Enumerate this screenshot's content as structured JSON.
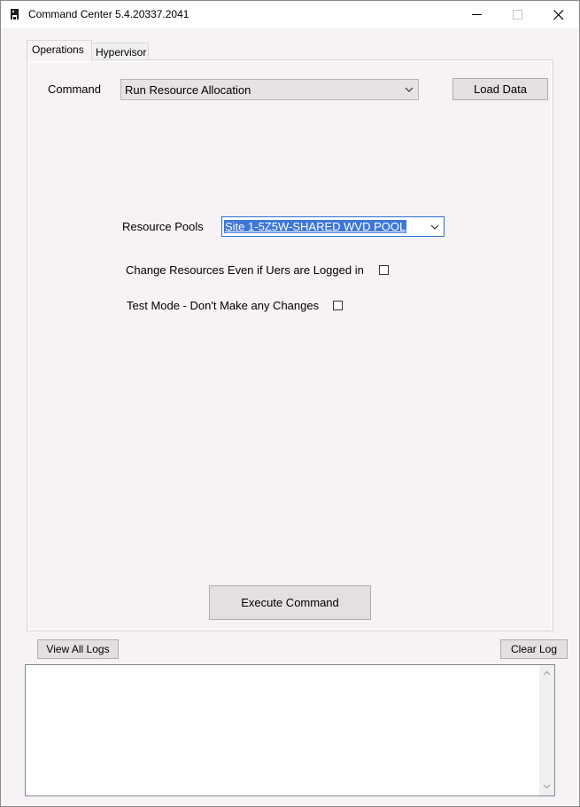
{
  "window": {
    "title": "Command Center 5.4.20337.2041",
    "app_icon": "app-icon",
    "controls": [
      "minimize-icon",
      "maximize-icon",
      "close-icon"
    ]
  },
  "tabs": [
    {
      "label": "Operations",
      "selected": true
    },
    {
      "label": "Hypervisor",
      "selected": false
    }
  ],
  "operations": {
    "command_label": "Command",
    "command_value": "Run Resource Allocation",
    "load_data_label": "Load Data",
    "resource_pools_label": "Resource Pools",
    "resource_pools_value": "Site 1-5Z5W-SHARED WVD POOL",
    "change_resources_label": "Change Resources Even if Uers are Logged in",
    "change_resources_checked": false,
    "test_mode_label": "Test Mode - Don't Make any Changes",
    "test_mode_checked": false,
    "execute_label": "Execute Command"
  },
  "log": {
    "view_all_label": "View All Logs",
    "clear_label": "Clear Log",
    "content": ""
  },
  "colors": {
    "window_bg": "#f6f2f5",
    "selection": "#3f77d8",
    "button_bg": "#e3dfe2"
  }
}
